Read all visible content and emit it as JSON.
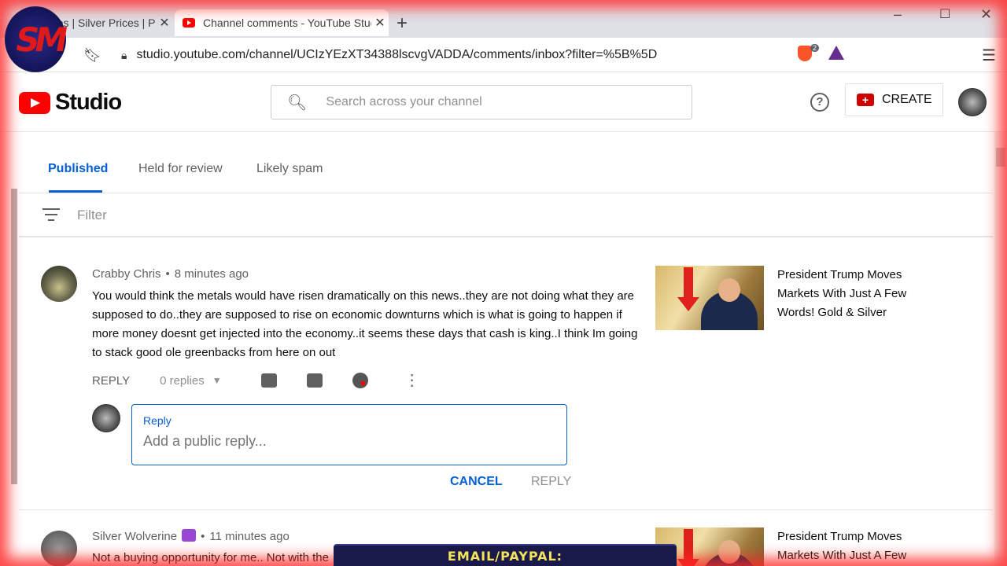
{
  "browser": {
    "tabs": [
      {
        "title": "rices | Silver Prices | Pl",
        "active": false
      },
      {
        "title": "Channel comments - YouTube Stud",
        "active": true
      }
    ],
    "url": "studio.youtube.com/channel/UCIzYEzXT34388lscvgVADDA/comments/inbox?filter=%5B%5D",
    "brave_badge": "2"
  },
  "header": {
    "logo_text": "Studio",
    "search_placeholder": "Search across your channel",
    "create_label": "CREATE"
  },
  "comment_tabs": [
    {
      "label": "Published",
      "active": true
    },
    {
      "label": "Held for review",
      "active": false
    },
    {
      "label": "Likely spam",
      "active": false
    }
  ],
  "filter_label": "Filter",
  "comments": [
    {
      "author": "Crabby Chris",
      "time": "8 minutes ago",
      "text": "You would think the metals would have risen dramatically on this news..they are not doing what they are supposed to do..they are supposed to rise on economic downturns which is what is going to happen if more money doesnt get injected into the economy..it seems these days that cash is king..I think Im going to stack good ole greenbacks from here on out",
      "reply_label": "REPLY",
      "replies": "0 replies",
      "video_title": "President Trump Moves Markets With Just A Few Words! Gold & Silver"
    },
    {
      "author": "Silver Wolverine",
      "time": "11 minutes ago",
      "text": "Not a buying opportunity for me.. Not with the",
      "video_title": "President Trump Moves Markets With Just A Few"
    }
  ],
  "reply_box": {
    "label": "Reply",
    "placeholder": "Add a public reply...",
    "cancel": "CANCEL",
    "submit": "REPLY"
  },
  "overlay": {
    "logo_text": "SM",
    "banner": "EMAIL/PAYPAL: SALIVATEMETAL@GMAIL.COM"
  },
  "colors": {
    "accent": "#065fd4",
    "youtube_red": "#ff0000",
    "frame_red": "#ff2828"
  }
}
